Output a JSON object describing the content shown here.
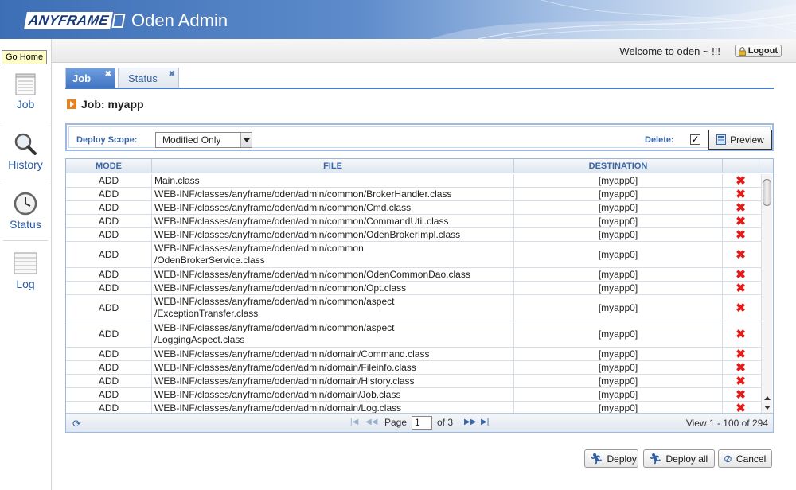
{
  "header": {
    "logo": "ANYFRAME",
    "title": "Oden Admin"
  },
  "tooltip": "Go Home",
  "nav": {
    "items": [
      {
        "label": "Job",
        "icon": "job-notepad-icon"
      },
      {
        "label": "History",
        "icon": "magnifier-icon"
      },
      {
        "label": "Status",
        "icon": "clock-icon"
      },
      {
        "label": "Log",
        "icon": "log-list-icon"
      }
    ]
  },
  "topbar": {
    "welcome": "Welcome to oden ~ !!!",
    "logout": "Logout"
  },
  "tabs": [
    {
      "label": "Job",
      "active": true
    },
    {
      "label": "Status",
      "active": false
    }
  ],
  "job": {
    "title": "Job: myapp"
  },
  "toolbar": {
    "deploy_scope_label": "Deploy Scope:",
    "deploy_scope_value": "Modified Only",
    "delete_label": "Delete:",
    "delete_checked": "✓",
    "preview": "Preview"
  },
  "grid": {
    "columns": [
      "MODE",
      "FILE",
      "DESTINATION"
    ],
    "rows": [
      {
        "mode": "ADD",
        "file": "Main.class",
        "dest": "[myapp0]"
      },
      {
        "mode": "ADD",
        "file": "WEB-INF/classes/anyframe/oden/admin/common/BrokerHandler.class",
        "dest": "[myapp0]"
      },
      {
        "mode": "ADD",
        "file": "WEB-INF/classes/anyframe/oden/admin/common/Cmd.class",
        "dest": "[myapp0]"
      },
      {
        "mode": "ADD",
        "file": "WEB-INF/classes/anyframe/oden/admin/common/CommandUtil.class",
        "dest": "[myapp0]"
      },
      {
        "mode": "ADD",
        "file": "WEB-INF/classes/anyframe/oden/admin/common/OdenBrokerImpl.class",
        "dest": "[myapp0]"
      },
      {
        "mode": "ADD",
        "file": "WEB-INF/classes/anyframe/oden/admin/common\n/OdenBrokerService.class",
        "dest": "[myapp0]"
      },
      {
        "mode": "ADD",
        "file": "WEB-INF/classes/anyframe/oden/admin/common/OdenCommonDao.class",
        "dest": "[myapp0]"
      },
      {
        "mode": "ADD",
        "file": "WEB-INF/classes/anyframe/oden/admin/common/Opt.class",
        "dest": "[myapp0]"
      },
      {
        "mode": "ADD",
        "file": "WEB-INF/classes/anyframe/oden/admin/common/aspect\n/ExceptionTransfer.class",
        "dest": "[myapp0]"
      },
      {
        "mode": "ADD",
        "file": "WEB-INF/classes/anyframe/oden/admin/common/aspect\n/LoggingAspect.class",
        "dest": "[myapp0]"
      },
      {
        "mode": "ADD",
        "file": "WEB-INF/classes/anyframe/oden/admin/domain/Command.class",
        "dest": "[myapp0]"
      },
      {
        "mode": "ADD",
        "file": "WEB-INF/classes/anyframe/oden/admin/domain/Fileinfo.class",
        "dest": "[myapp0]"
      },
      {
        "mode": "ADD",
        "file": "WEB-INF/classes/anyframe/oden/admin/domain/History.class",
        "dest": "[myapp0]"
      },
      {
        "mode": "ADD",
        "file": "WEB-INF/classes/anyframe/oden/admin/domain/Job.class",
        "dest": "[myapp0]"
      },
      {
        "mode": "ADD",
        "file": "WEB-INF/classes/anyframe/oden/admin/domain/Log.class",
        "dest": "[myapp0]"
      }
    ],
    "pager": {
      "page_label": "Page",
      "page_value": "1",
      "of_label": "of 3",
      "view": "View 1 - 100 of 294"
    }
  },
  "buttons": {
    "deploy": "Deploy",
    "deploy_all": "Deploy all",
    "cancel": "Cancel"
  }
}
